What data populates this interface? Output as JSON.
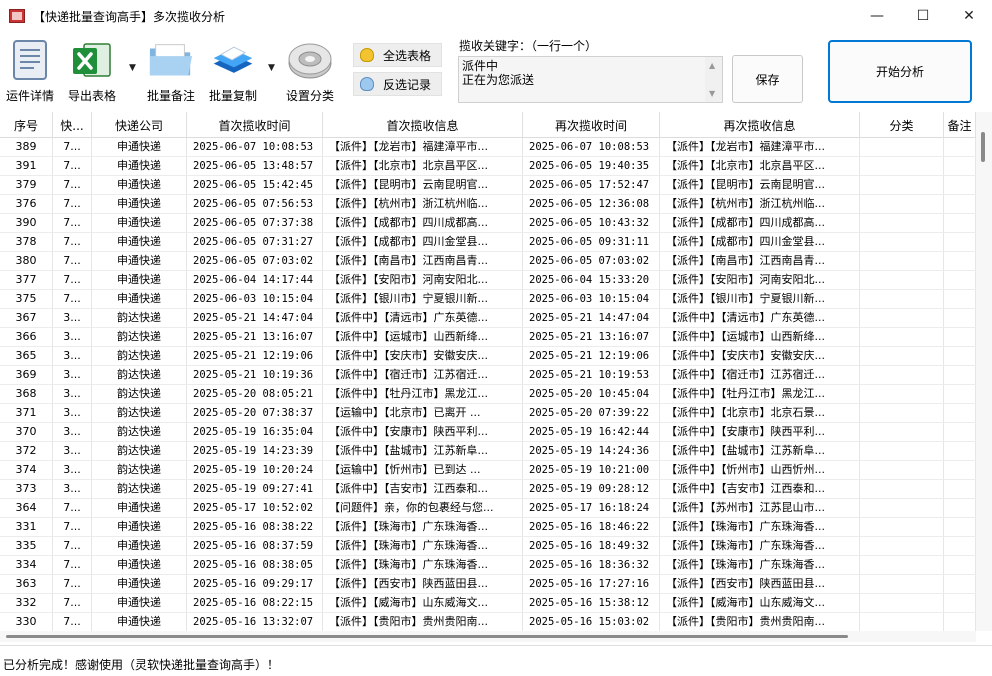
{
  "window": {
    "title": "【快递批量查询高手】多次揽收分析",
    "minimize": "—",
    "maximize": "☐",
    "close": "✕"
  },
  "toolbar": {
    "detail_label": "运件详情",
    "export_label": "导出表格",
    "batch_note_label": "批量备注",
    "batch_copy_label": "批量复制",
    "settings_label": "设置分类",
    "select_all_label": "全选表格",
    "invert_label": "反选记录",
    "keyword_label": "揽收关键字：（一行一个）",
    "keyword_value": "派件中\n正在为您派送",
    "save_label": "保存",
    "start_label": "开始分析"
  },
  "table": {
    "columns": [
      "序号",
      "快...",
      "快递公司",
      "首次揽收时间",
      "首次揽收信息",
      "再次揽收时间",
      "再次揽收信息",
      "分类",
      "备注"
    ],
    "rows": [
      [
        "389",
        "7...",
        "申通快递",
        "2025-06-07 10:08:53",
        "【派件】【龙岩市】福建漳平市...",
        "2025-06-07 10:08:53",
        "【派件】【龙岩市】福建漳平市...",
        "",
        ""
      ],
      [
        "391",
        "7...",
        "申通快递",
        "2025-06-05 13:48:57",
        "【派件】【北京市】北京昌平区...",
        "2025-06-05 19:40:35",
        "【派件】【北京市】北京昌平区...",
        "",
        ""
      ],
      [
        "379",
        "7...",
        "申通快递",
        "2025-06-05 15:42:45",
        "【派件】【昆明市】云南昆明官...",
        "2025-06-05 17:52:47",
        "【派件】【昆明市】云南昆明官...",
        "",
        ""
      ],
      [
        "376",
        "7...",
        "申通快递",
        "2025-06-05 07:56:53",
        "【派件】【杭州市】浙江杭州临...",
        "2025-06-05 12:36:08",
        "【派件】【杭州市】浙江杭州临...",
        "",
        ""
      ],
      [
        "390",
        "7...",
        "申通快递",
        "2025-06-05 07:37:38",
        "【派件】【成都市】四川成都高...",
        "2025-06-05 10:43:32",
        "【派件】【成都市】四川成都高...",
        "",
        ""
      ],
      [
        "378",
        "7...",
        "申通快递",
        "2025-06-05 07:31:27",
        "【派件】【成都市】四川金堂县...",
        "2025-06-05 09:31:11",
        "【派件】【成都市】四川金堂县...",
        "",
        ""
      ],
      [
        "380",
        "7...",
        "申通快递",
        "2025-06-05 07:03:02",
        "【派件】【南昌市】江西南昌青...",
        "2025-06-05 07:03:02",
        "【派件】【南昌市】江西南昌青...",
        "",
        ""
      ],
      [
        "377",
        "7...",
        "申通快递",
        "2025-06-04 14:17:44",
        "【派件】【安阳市】河南安阳北...",
        "2025-06-04 15:33:20",
        "【派件】【安阳市】河南安阳北...",
        "",
        ""
      ],
      [
        "375",
        "7...",
        "申通快递",
        "2025-06-03 10:15:04",
        "【派件】【银川市】宁夏银川新...",
        "2025-06-03 10:15:04",
        "【派件】【银川市】宁夏银川新...",
        "",
        ""
      ],
      [
        "367",
        "3...",
        "韵达快递",
        "2025-05-21 14:47:04",
        "【派件中】【清远市】广东英德...",
        "2025-05-21 14:47:04",
        "【派件中】【清远市】广东英德...",
        "",
        ""
      ],
      [
        "366",
        "3...",
        "韵达快递",
        "2025-05-21 13:16:07",
        "【派件中】【运城市】山西新绛...",
        "2025-05-21 13:16:07",
        "【派件中】【运城市】山西新绛...",
        "",
        ""
      ],
      [
        "365",
        "3...",
        "韵达快递",
        "2025-05-21 12:19:06",
        "【派件中】【安庆市】安徽安庆...",
        "2025-05-21 12:19:06",
        "【派件中】【安庆市】安徽安庆...",
        "",
        ""
      ],
      [
        "369",
        "3...",
        "韵达快递",
        "2025-05-21 10:19:36",
        "【派件中】【宿迁市】江苏宿迁...",
        "2025-05-21 10:19:53",
        "【派件中】【宿迁市】江苏宿迁...",
        "",
        ""
      ],
      [
        "368",
        "3...",
        "韵达快递",
        "2025-05-20 08:05:21",
        "【派件中】【牡丹江市】黑龙江...",
        "2025-05-20 10:45:04",
        "【派件中】【牡丹江市】黑龙江...",
        "",
        ""
      ],
      [
        "371",
        "3...",
        "韵达快递",
        "2025-05-20 07:38:37",
        "【运输中】【北京市】已离开 ...",
        "2025-05-20 07:39:22",
        "【派件中】【北京市】北京石景...",
        "",
        ""
      ],
      [
        "370",
        "3...",
        "韵达快递",
        "2025-05-19 16:35:04",
        "【派件中】【安康市】陕西平利...",
        "2025-05-19 16:42:44",
        "【派件中】【安康市】陕西平利...",
        "",
        ""
      ],
      [
        "372",
        "3...",
        "韵达快递",
        "2025-05-19 14:23:39",
        "【派件中】【盐城市】江苏新阜...",
        "2025-05-19 14:24:36",
        "【派件中】【盐城市】江苏新阜...",
        "",
        ""
      ],
      [
        "374",
        "3...",
        "韵达快递",
        "2025-05-19 10:20:24",
        "【运输中】【忻州市】已到达 ...",
        "2025-05-19 10:21:00",
        "【派件中】【忻州市】山西忻州...",
        "",
        ""
      ],
      [
        "373",
        "3...",
        "韵达快递",
        "2025-05-19 09:27:41",
        "【派件中】【吉安市】江西泰和...",
        "2025-05-19 09:28:12",
        "【派件中】【吉安市】江西泰和...",
        "",
        ""
      ],
      [
        "364",
        "7...",
        "申通快递",
        "2025-05-17 10:52:02",
        "【问题件】亲，你的包裹经与您...",
        "2025-05-17 16:18:24",
        "【派件】【苏州市】江苏昆山市...",
        "",
        ""
      ],
      [
        "331",
        "7...",
        "申通快递",
        "2025-05-16 08:38:22",
        "【派件】【珠海市】广东珠海香...",
        "2025-05-16 18:46:22",
        "【派件】【珠海市】广东珠海香...",
        "",
        ""
      ],
      [
        "335",
        "7...",
        "申通快递",
        "2025-05-16 08:37:59",
        "【派件】【珠海市】广东珠海香...",
        "2025-05-16 18:49:32",
        "【派件】【珠海市】广东珠海香...",
        "",
        ""
      ],
      [
        "334",
        "7...",
        "申通快递",
        "2025-05-16 08:38:05",
        "【派件】【珠海市】广东珠海香...",
        "2025-05-16 18:36:32",
        "【派件】【珠海市】广东珠海香...",
        "",
        ""
      ],
      [
        "363",
        "7...",
        "申通快递",
        "2025-05-16 09:29:17",
        "【派件】【西安市】陕西蓝田县...",
        "2025-05-16 17:27:16",
        "【派件】【西安市】陕西蓝田县...",
        "",
        ""
      ],
      [
        "332",
        "7...",
        "申通快递",
        "2025-05-16 08:22:15",
        "【派件】【威海市】山东威海文...",
        "2025-05-16 15:38:12",
        "【派件】【威海市】山东威海文...",
        "",
        ""
      ],
      [
        "330",
        "7...",
        "申通快递",
        "2025-05-16 13:32:07",
        "【派件】【贵阳市】贵州贵阳南...",
        "2025-05-16 15:03:02",
        "【派件】【贵阳市】贵州贵阳南...",
        "",
        ""
      ]
    ]
  },
  "status": {
    "text": "已分析完成！感谢使用（灵软快递批量查询高手）！"
  }
}
